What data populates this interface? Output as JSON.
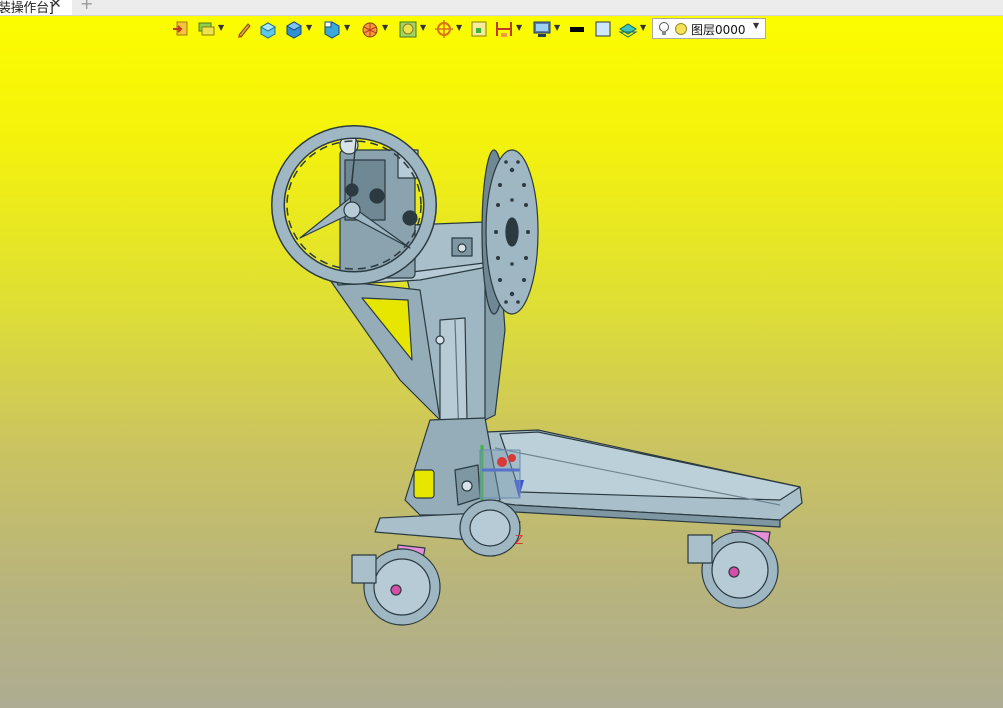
{
  "tabs": [
    {
      "label": "装操作台]",
      "active": true
    }
  ],
  "new_tab_label": "+",
  "toolbar": {
    "tools": [
      {
        "icon": "exit-icon",
        "dropdown": false
      },
      {
        "icon": "layer-manager-icon",
        "dropdown": true
      },
      {
        "icon": "pencil-icon",
        "dropdown": false
      },
      {
        "icon": "box-solid-icon",
        "dropdown": false
      },
      {
        "icon": "cube-icon",
        "dropdown": true
      },
      {
        "icon": "view-orientation-icon",
        "dropdown": true
      },
      {
        "icon": "render-style-icon",
        "dropdown": true
      },
      {
        "icon": "display-filter-icon",
        "dropdown": true
      },
      {
        "icon": "snap-target-icon",
        "dropdown": true
      },
      {
        "icon": "grid-icon",
        "dropdown": false
      },
      {
        "icon": "dimension-icon",
        "dropdown": true
      },
      {
        "icon": "monitor-icon",
        "dropdown": true
      },
      {
        "icon": "line-color-icon",
        "dropdown": false
      },
      {
        "icon": "fill-color-icon",
        "dropdown": false
      },
      {
        "icon": "layer-stack-icon",
        "dropdown": true
      }
    ],
    "layer_selector": {
      "value": "图层0000",
      "icon": "lightbulb-icon"
    }
  },
  "colors": {
    "viewport_top": "#fcfc00",
    "viewport_bottom": "#aeac92",
    "model_steel": "#9fb7c3",
    "model_edge": "#2b3a40",
    "caster_bracket": "#e58fd8",
    "axis_green": "#3cb53c",
    "axis_blue": "#3a52d8",
    "axis_red": "#d83a3a"
  },
  "axis_label_z": "Z"
}
